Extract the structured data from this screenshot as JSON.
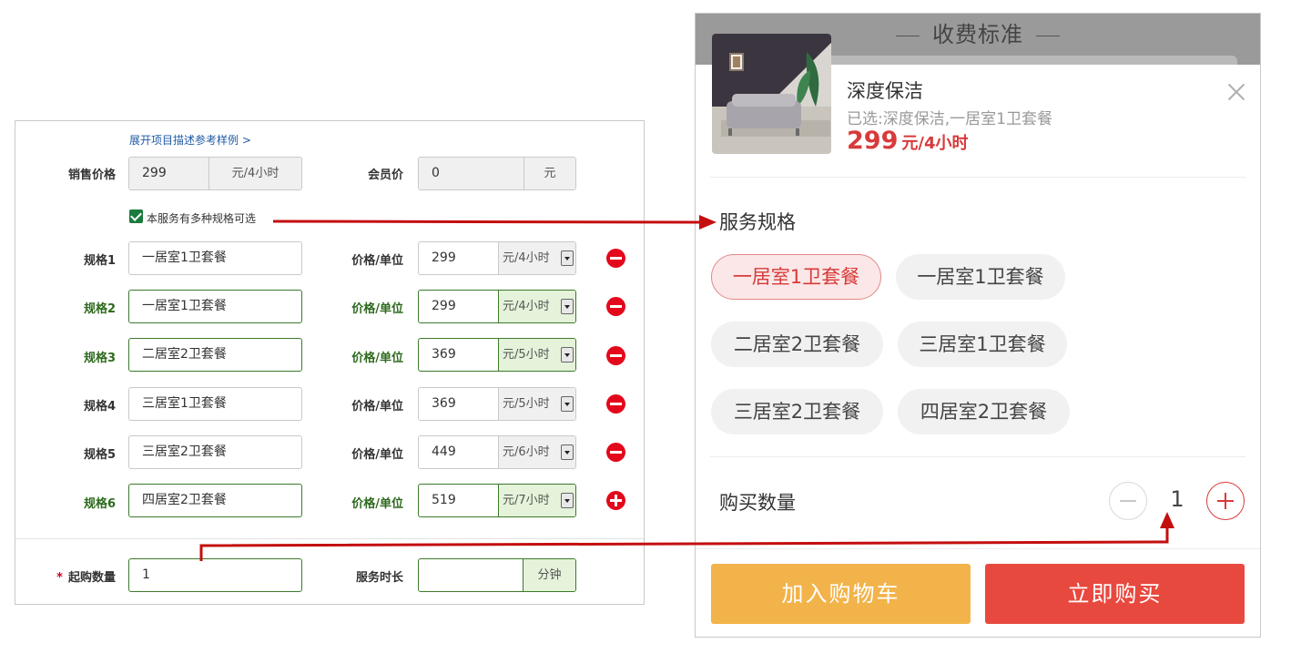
{
  "form": {
    "expand_link": "展开项目描述参考样例 >",
    "sale_price_label": "销售价格",
    "sale_price_value": "299",
    "sale_price_unit": "元/4小时",
    "member_price_label": "会员价",
    "member_price_value": "0",
    "member_price_unit": "元",
    "multi_spec_checked": true,
    "multi_spec_label": "本服务有多种规格可选",
    "price_unit_label": "价格/单位",
    "specs": [
      {
        "label": "规格1",
        "name": "一居室1卫套餐",
        "price": "299",
        "unit": "元/4小时",
        "highlighted": false,
        "action": "remove"
      },
      {
        "label": "规格2",
        "name": "一居室1卫套餐",
        "price": "299",
        "unit": "元/4小时",
        "highlighted": true,
        "action": "remove"
      },
      {
        "label": "规格3",
        "name": "二居室2卫套餐",
        "price": "369",
        "unit": "元/5小时",
        "highlighted": true,
        "action": "remove"
      },
      {
        "label": "规格4",
        "name": "三居室1卫套餐",
        "price": "369",
        "unit": "元/5小时",
        "highlighted": false,
        "action": "remove"
      },
      {
        "label": "规格5",
        "name": "三居室2卫套餐",
        "price": "449",
        "unit": "元/6小时",
        "highlighted": false,
        "action": "remove"
      },
      {
        "label": "规格6",
        "name": "四居室2卫套餐",
        "price": "519",
        "unit": "元/7小时",
        "highlighted": true,
        "action": "add"
      }
    ],
    "required_mark": "*",
    "min_qty_label": "起购数量",
    "min_qty_value": "1",
    "duration_label": "服务时长",
    "duration_value": "",
    "duration_unit": "分钟"
  },
  "popup": {
    "header_title": "收费标准",
    "product_name": "深度保洁",
    "selected_text": "已选:深度保洁,一居室1卫套餐",
    "price": "299",
    "price_unit": "元/4小时",
    "spec_section_title": "服务规格",
    "spec_options": [
      "一居室1卫套餐",
      "一居室1卫套餐",
      "二居室2卫套餐",
      "三居室1卫套餐",
      "三居室2卫套餐",
      "四居室2卫套餐"
    ],
    "selected_spec_index": 0,
    "qty_label": "购买数量",
    "qty_value": "1",
    "add_to_cart": "加入购物车",
    "buy_now": "立即购买"
  },
  "colors": {
    "accent_red": "#d83a3a",
    "cart_orange": "#f2b34a",
    "buy_red": "#e8493f",
    "form_green": "#2d6a1e",
    "remove_red": "#e3081b"
  },
  "icons": [
    "checkbox-checked-icon",
    "minus-circle-icon",
    "plus-circle-icon",
    "close-icon",
    "dropdown-arrow-icon"
  ]
}
